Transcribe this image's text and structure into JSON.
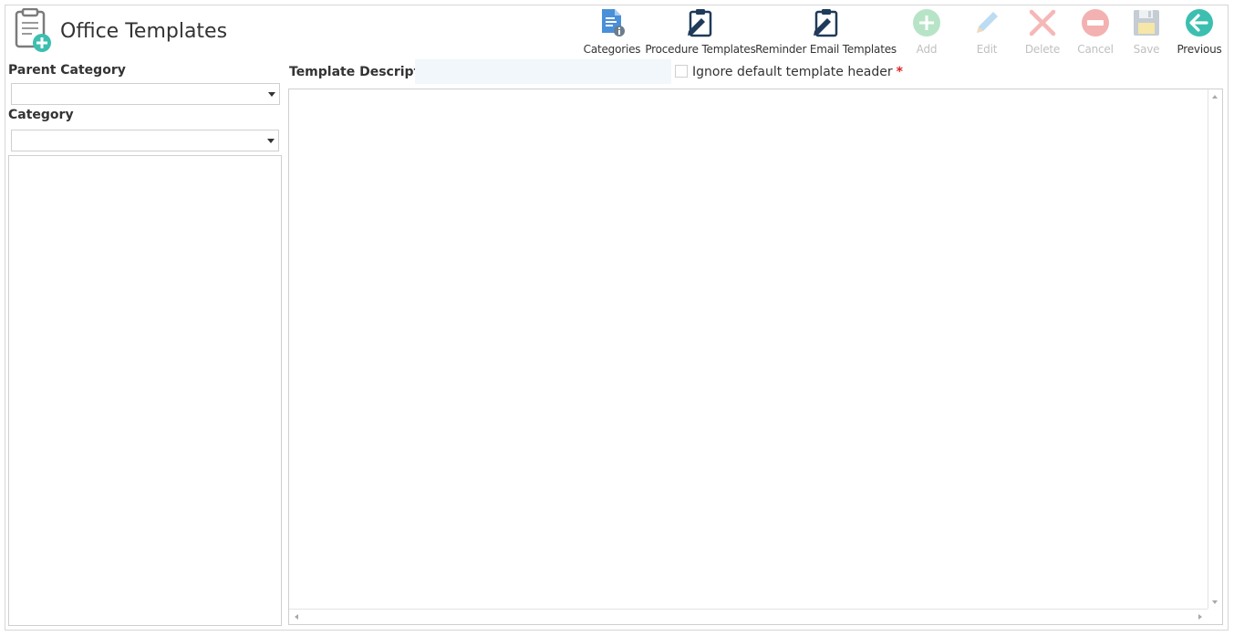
{
  "header": {
    "title": "Office Templates",
    "app_icon": "clipboard-add-icon"
  },
  "toolbar": {
    "buttons": [
      {
        "label": "Categories",
        "icon": "document-info-icon",
        "enabled": true
      },
      {
        "label": "Procedure Templates",
        "icon": "clipboard-pen-icon",
        "enabled": true
      },
      {
        "label": "Reminder Email Templates",
        "icon": "clipboard-pen-icon",
        "enabled": true
      },
      {
        "label": "Add",
        "icon": "plus-circle-icon",
        "enabled": false
      },
      {
        "label": "Edit",
        "icon": "pencil-icon",
        "enabled": false
      },
      {
        "label": "Delete",
        "icon": "x-icon",
        "enabled": false
      },
      {
        "label": "Cancel",
        "icon": "minus-circle-icon",
        "enabled": false
      },
      {
        "label": "Save",
        "icon": "floppy-disk-icon",
        "enabled": false
      },
      {
        "label": "Previous",
        "icon": "arrow-left-circle-icon",
        "enabled": true
      }
    ]
  },
  "left": {
    "parent_category_label": "Parent Category",
    "parent_category_value": "",
    "category_label": "Category",
    "category_value": "",
    "list_items": []
  },
  "main": {
    "template_description_label": "Template Description",
    "template_description_value": "",
    "ignore_header_label": "Ignore default template header",
    "ignore_header_checked": false,
    "required_marker": "*",
    "editor_content": ""
  },
  "colors": {
    "accent_teal": "#3cbfb0",
    "icon_navy": "#1f3a5a",
    "icon_blue": "#4a90d9",
    "disabled_label": "#c0c0c0",
    "required_red": "#e02020",
    "input_bg": "#f1f7fb"
  }
}
